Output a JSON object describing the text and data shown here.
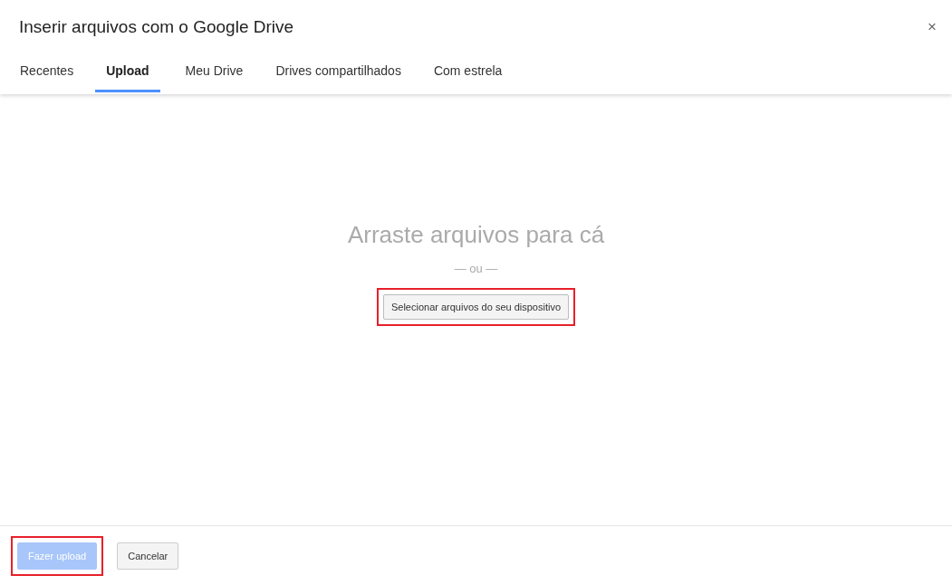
{
  "window": {
    "title": "Inserir arquivos com o Google Drive",
    "close": "×"
  },
  "tabs": [
    {
      "label": "Recentes",
      "selected": false
    },
    {
      "label": "Upload",
      "selected": true
    },
    {
      "label": "Meu Drive",
      "selected": false
    },
    {
      "label": "Drives compartilhados",
      "selected": false
    },
    {
      "label": "Com estrela",
      "selected": false
    }
  ],
  "drop_area": {
    "heading": "Arraste arquivos para cá",
    "separator": "— ou —",
    "button": {
      "label": "Selecionar arquivos do seu dispositivo",
      "highlighted": true
    }
  },
  "footer": {
    "buttons": [
      {
        "label": "Fazer upload",
        "kind": "primary",
        "disabled": true,
        "highlighted": true
      },
      {
        "label": "Cancelar",
        "kind": "secondary",
        "disabled": false,
        "highlighted": false
      }
    ]
  }
}
